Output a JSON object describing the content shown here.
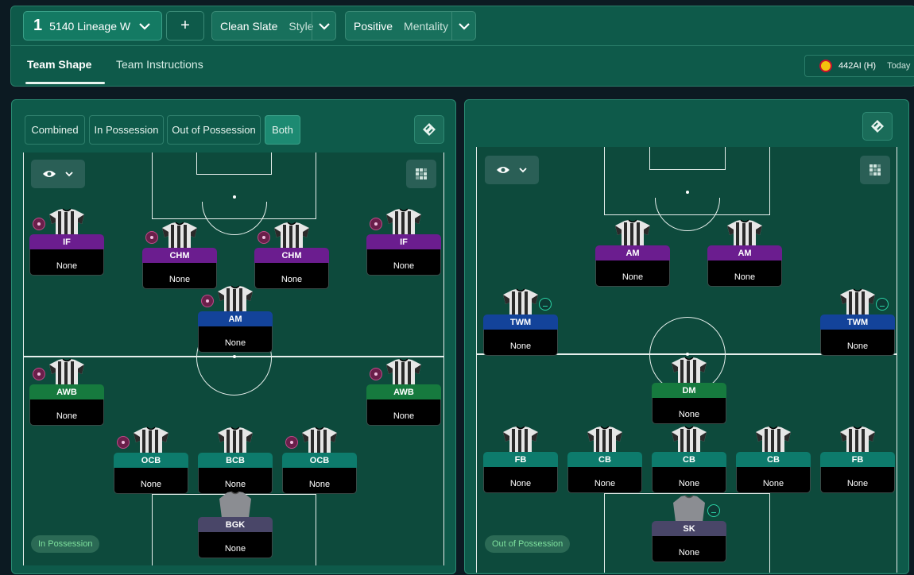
{
  "header": {
    "tactic_number": "1",
    "tactic_name": "5140 Lineage W",
    "add_label": "+",
    "style_value": "Clean Slate",
    "style_label": "Style",
    "mentality_value": "Positive",
    "mentality_label": "Mentality",
    "tabs": [
      "Team Shape",
      "Team Instructions"
    ],
    "match_formation": "442AI (H)",
    "match_date": "Today"
  },
  "view_buttons": [
    "Combined",
    "In Possession",
    "Out of Possession",
    "Both"
  ],
  "left_pitch": {
    "phase_label": "In Possession",
    "players": [
      {
        "role": "IF",
        "player": "None"
      },
      {
        "role": "CHM",
        "player": "None"
      },
      {
        "role": "CHM",
        "player": "None"
      },
      {
        "role": "IF",
        "player": "None"
      },
      {
        "role": "AM",
        "player": "None"
      },
      {
        "role": "AWB",
        "player": "None"
      },
      {
        "role": "AWB",
        "player": "None"
      },
      {
        "role": "OCB",
        "player": "None"
      },
      {
        "role": "BCB",
        "player": "None"
      },
      {
        "role": "OCB",
        "player": "None"
      },
      {
        "role": "BGK",
        "player": "None"
      }
    ]
  },
  "right_pitch": {
    "phase_label": "Out of Possession",
    "players": [
      {
        "role": "AM",
        "player": "None"
      },
      {
        "role": "AM",
        "player": "None"
      },
      {
        "role": "TWM",
        "player": "None"
      },
      {
        "role": "TWM",
        "player": "None"
      },
      {
        "role": "DM",
        "player": "None"
      },
      {
        "role": "FB",
        "player": "None"
      },
      {
        "role": "CB",
        "player": "None"
      },
      {
        "role": "CB",
        "player": "None"
      },
      {
        "role": "CB",
        "player": "None"
      },
      {
        "role": "FB",
        "player": "None"
      },
      {
        "role": "SK",
        "player": "None"
      }
    ]
  },
  "colors": {
    "attack_role": "#6b1d8f",
    "midfield_role": "#13439a",
    "wingback_role": "#167a3e",
    "defence_role": "#0d7b6c",
    "keeper_role": "#494668",
    "panel": "#0e5a4a",
    "pitch": "#0d4a3c"
  },
  "icons": {
    "dropdown": "chevron-down-icon",
    "visibility": "eye-icon",
    "grid": "grid-icon",
    "expand": "expand-icon",
    "kit": "shirt-icon"
  }
}
